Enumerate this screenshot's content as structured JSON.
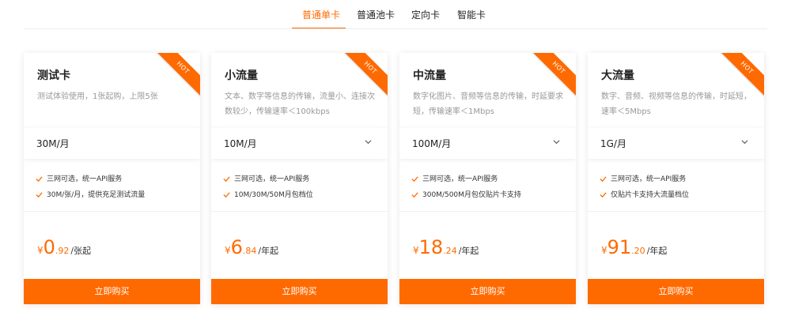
{
  "tabs": [
    "普通单卡",
    "普通池卡",
    "定向卡",
    "智能卡"
  ],
  "hot_label": "HOT",
  "accent_color": "#ff6a00",
  "cards": [
    {
      "title": "测试卡",
      "desc": "测试体验使用，1张起购，上限5张",
      "select": "30M/月",
      "features": [
        "三网可选，统一API服务",
        "30M/张/月，提供充足测试流量"
      ],
      "price_currency": "¥",
      "price_int": "0",
      "price_dec": ".92",
      "price_unit": "/张起",
      "buy": "立即购买"
    },
    {
      "title": "小流量",
      "desc": "文本、数字等信息的传输，流量小、连接次数较少，传输速率＜100kbps",
      "select": "10M/月",
      "features": [
        "三网可选，统一API服务",
        "10M/30M/50M月包档位"
      ],
      "price_currency": "¥",
      "price_int": "6",
      "price_dec": ".84",
      "price_unit": "/年起",
      "buy": "立即购买"
    },
    {
      "title": "中流量",
      "desc": "数字化图片、音频等信息的传输，时延要求短，传输速率＜1Mbps",
      "select": "100M/月",
      "features": [
        "三网可选，统一API服务",
        "300M/500M月包仅贴片卡支持"
      ],
      "price_currency": "¥",
      "price_int": "18",
      "price_dec": ".24",
      "price_unit": "/年起",
      "buy": "立即购买"
    },
    {
      "title": "大流量",
      "desc": "数字、音频、视频等信息的传输，时延短，速率＜5Mbps",
      "select": "1G/月",
      "features": [
        "三网可选，统一API服务",
        "仅贴片卡支持大流量档位"
      ],
      "price_currency": "¥",
      "price_int": "91",
      "price_dec": ".20",
      "price_unit": "/年起",
      "buy": "立即购买"
    }
  ]
}
